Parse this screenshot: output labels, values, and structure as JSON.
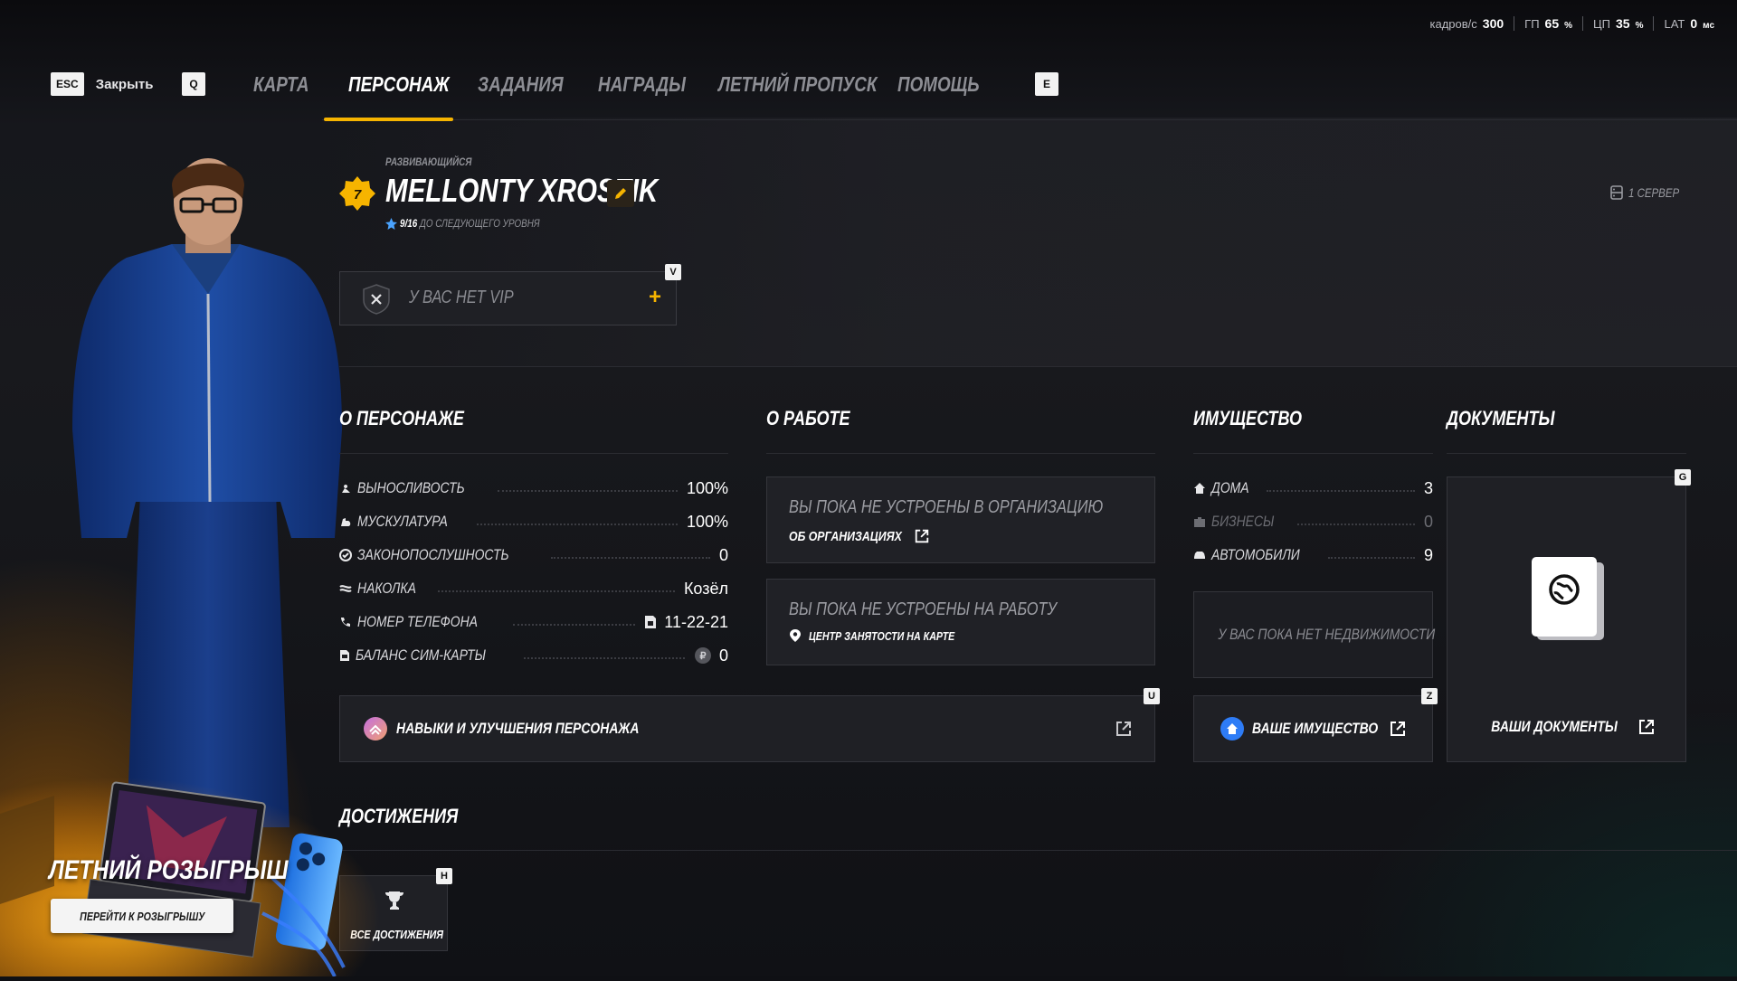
{
  "perf": {
    "fps_label": "кадров/с",
    "fps_value": "300",
    "gpu_label": "ГП",
    "gpu_value": "65",
    "gpu_unit": "%",
    "cpu_label": "ЦП",
    "cpu_value": "35",
    "cpu_unit": "%",
    "lat_label": "LAT",
    "lat_value": "0",
    "lat_unit": "мс"
  },
  "nav": {
    "esc_key": "ESC",
    "close_label": "Закрыть",
    "prev_key": "Q",
    "next_key": "E",
    "tabs": [
      {
        "label": "Карта",
        "active": false
      },
      {
        "label": "Персонаж",
        "active": true
      },
      {
        "label": "Задания",
        "active": false
      },
      {
        "label": "Награды",
        "active": false
      },
      {
        "label": "Летний пропуск",
        "active": false
      },
      {
        "label": "Помощь",
        "active": false
      }
    ]
  },
  "character": {
    "rank": "Развивающийся",
    "level": "7",
    "name": "MELLONTY XROSTIK",
    "xp_current": "9",
    "xp_total": "/16",
    "xp_suffix": "до следующего уровня",
    "server": "1 сервер"
  },
  "vip": {
    "label": "У вас нет VIP",
    "key": "V",
    "plus": "+"
  },
  "about": {
    "title": "О персонаже",
    "rows": [
      {
        "label": "Выносливость",
        "value": "100%",
        "icon": "runner-icon"
      },
      {
        "label": "Мускулатура",
        "value": "100%",
        "icon": "muscle-icon"
      },
      {
        "label": "Законопослушность",
        "value": "0",
        "icon": "law-icon"
      },
      {
        "label": "Наколка",
        "value": "Козёл",
        "icon": "tattoo-icon"
      },
      {
        "label": "Номер телефона",
        "value": "11-22-21",
        "icon": "phone-icon"
      },
      {
        "label": "Баланс сим-карты",
        "value": "0",
        "icon": "sim-icon"
      }
    ],
    "skills_label": "Навыки и улучшения персонажа",
    "skills_key": "U"
  },
  "work": {
    "title": "О работе",
    "org_text": "Вы пока не устроены в организацию",
    "org_link": "Об организациях",
    "job_text": "Вы пока не устроены на работу",
    "job_link": "Центр занятости на карте"
  },
  "property": {
    "title": "Имущество",
    "rows": [
      {
        "label": "Дома",
        "value": "3",
        "dim": false
      },
      {
        "label": "Бизнесы",
        "value": "0",
        "dim": true
      },
      {
        "label": "Автомобили",
        "value": "9",
        "dim": false
      }
    ],
    "empty_text": "У вас пока нет недвижимости",
    "button_label": "Ваше имущество",
    "button_key": "Z"
  },
  "documents": {
    "title": "Документы",
    "key": "G",
    "button_label": "Ваши документы"
  },
  "achievements": {
    "title": "Достижения",
    "key": "H",
    "card_label": "Все достижения"
  },
  "promo": {
    "title": "Летний розыгрыш",
    "button_label": "Перейти к розыгрышу"
  },
  "colors": {
    "accent": "#f6b400",
    "background": "#111216",
    "card": "#202126"
  }
}
